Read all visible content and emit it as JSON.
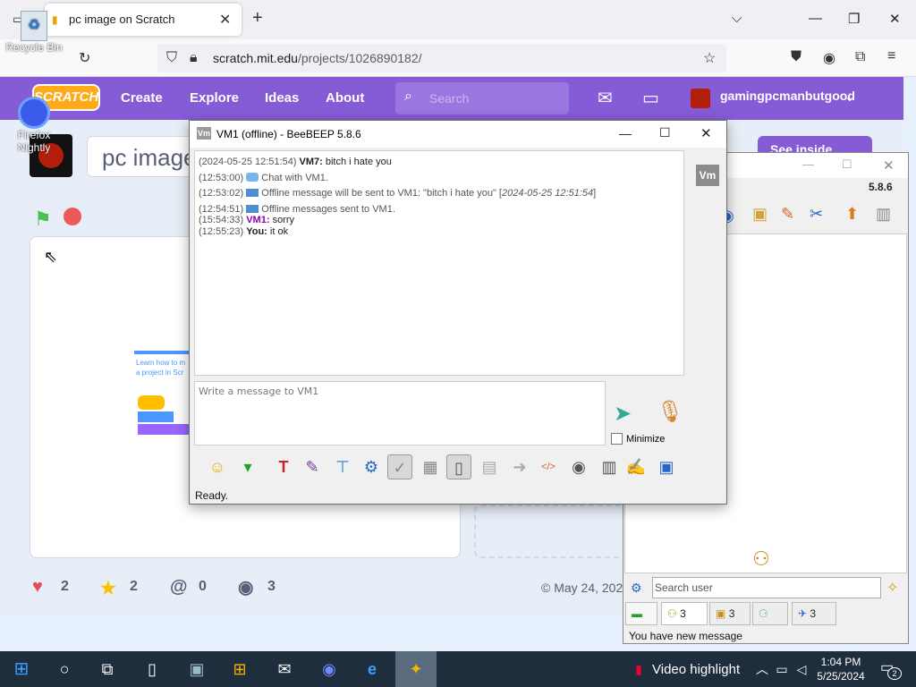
{
  "browser": {
    "tab_title": "pc image on Scratch",
    "url_domain": "scratch.mit.edu",
    "url_path": "/projects/1026890182/"
  },
  "scratch": {
    "logo": "SCRATCH",
    "nav": [
      "Create",
      "Explore",
      "Ideas",
      "About"
    ],
    "search_placeholder": "Search",
    "username": "gamingpcmanbutgood",
    "project_title": "pc image on Scratch",
    "see_inside": "See inside",
    "tutorial_text": "Learn how to m a project in Scr",
    "stats": {
      "loves": "2",
      "favorites": "2",
      "remixes": "0",
      "views": "3"
    },
    "shared_date": "© May 24, 202"
  },
  "desktop": {
    "recycle_bin": "Recycle Bin",
    "firefox": "Firefox Nightly"
  },
  "beebeep_main": {
    "version": "5.8.6",
    "search_placeholder": "Search user",
    "tabs": [
      "",
      "3",
      "3",
      "",
      "3"
    ],
    "status_message": "You have new message"
  },
  "chat": {
    "title": "VM1 (offline) - BeeBEEP 5.8.6",
    "avatar": "Vm",
    "messages": [
      {
        "time": "(2024-05-25 12:51:54)",
        "sender": "VM7:",
        "text": "bitch i hate you",
        "kind": "user"
      },
      {
        "time": "(12:53:00)",
        "text": "Chat with VM1.",
        "kind": "system-chat"
      },
      {
        "time": "(12:53:02)",
        "text": "Offline message will be sent to VM1: \"bitch i hate you\" [",
        "date_em": "2024-05-25 12:51:54",
        "text_end": "]",
        "kind": "system-mail"
      },
      {
        "time": "(12:54:51)",
        "text": "Offline messages sent to VM1.",
        "kind": "system-mail"
      },
      {
        "time": "(15:54:33)",
        "sender": "VM1:",
        "text": "sorry",
        "kind": "vm1"
      },
      {
        "time": "(12:55:23)",
        "sender": "You:",
        "text": "it ok",
        "kind": "user"
      }
    ],
    "input_placeholder": "Write a message to VM1",
    "minimize_label": "Minimize",
    "status": "Ready."
  },
  "taskbar": {
    "video_highlight": "Video highlight",
    "time": "1:04 PM",
    "date": "5/25/2024",
    "notifications": "2"
  }
}
